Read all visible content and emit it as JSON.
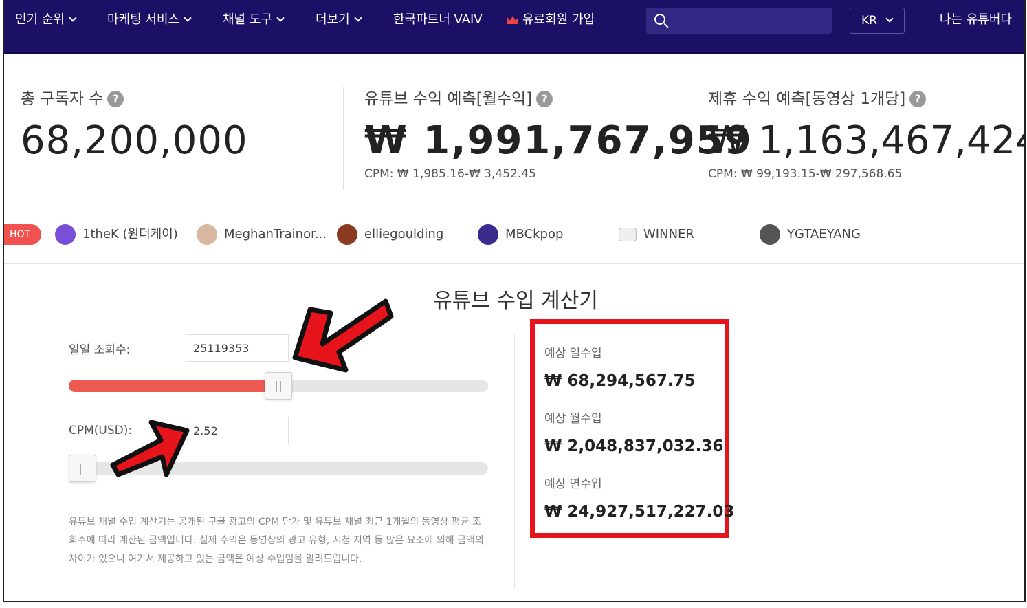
{
  "nav": {
    "items": [
      {
        "label": "인기 순위",
        "dropdown": true
      },
      {
        "label": "마케팅 서비스",
        "dropdown": true
      },
      {
        "label": "채널 도구",
        "dropdown": true
      },
      {
        "label": "더보기",
        "dropdown": true
      },
      {
        "label": "한국파트너 VAIV",
        "dropdown": false
      },
      {
        "label": "유료회원 가입",
        "dropdown": false
      }
    ],
    "search_placeholder": "",
    "language": "KR",
    "right_link": "나는 유튜버다"
  },
  "stats": {
    "subscribers": {
      "label": "총 구독자 수",
      "value": "68,200,000"
    },
    "youtube_revenue": {
      "label": "유튜브 수익 예측[월수익]",
      "value": "₩ 1,991,767,959",
      "cpm": "CPM: ₩ 1,985.16-₩ 3,452.45"
    },
    "partner_revenue": {
      "label": "제휴 수익 예측[동영상 1개당]",
      "value": "₩ 1,163,467,424",
      "cpm": "CPM: ₩ 99,193.15-₩ 297,568.65"
    },
    "help_glyph": "?"
  },
  "hot": {
    "badge": "HOT",
    "channels": [
      {
        "name": "1theK (원더케이)",
        "color": "#7a4fd8"
      },
      {
        "name": "MeghanTrainor...",
        "color": "#d8b8a0"
      },
      {
        "name": "elliegoulding",
        "color": "#8a3a1e"
      },
      {
        "name": "MBCkpop",
        "color": "#3c2a8c"
      },
      {
        "name": "WINNER",
        "color": "#bbbbbb"
      },
      {
        "name": "YGTAEYANG",
        "color": "#555555"
      }
    ]
  },
  "calculator": {
    "title": "유튜브 수입 계산기",
    "daily_views_label": "일일 조회수:",
    "daily_views_value": "25119353",
    "daily_views_slider_fraction": 0.5,
    "cpm_label": "CPM(USD):",
    "cpm_value": "2.52",
    "cpm_slider_fraction": 0.0,
    "note": "유튜브 채널 수입 계산기는 공개된 구글 광고의 CPM 단가 및 유튜브 채널 최근 1개월의 동영상 평균 조회수에 따라 계산된 금액입니다. 실제 수익은 동영상의 광고 유형, 시청 지역 등 많은 요소에 의해 금액의 차이가 있으니 여기서 제공하고 있는 금액은 예상 수입임을 알려드립니다."
  },
  "results": {
    "daily_label": "예상 일수입",
    "daily_value": "₩ 68,294,567.75",
    "monthly_label": "예상 월수입",
    "monthly_value": "₩ 2,048,837,032.36",
    "yearly_label": "예상 연수입",
    "yearly_value": "₩ 24,927,517,227.03"
  },
  "colors": {
    "nav_bg": "#1a1166",
    "accent_red": "#e8141c",
    "slider_fill": "#ec5a52",
    "hot_badge": "#f0524f"
  }
}
